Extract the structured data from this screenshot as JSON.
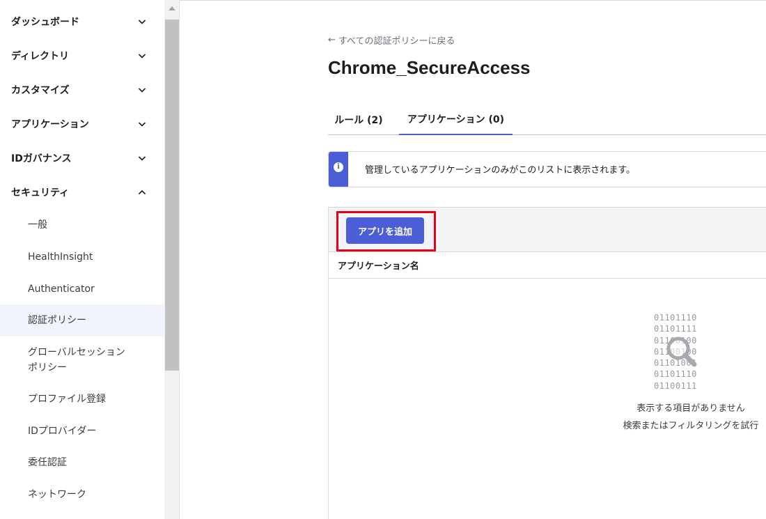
{
  "sidebar": {
    "top_items": [
      {
        "label": "ダッシュボード",
        "expanded": false
      },
      {
        "label": "ディレクトリ",
        "expanded": false
      },
      {
        "label": "カスタマイズ",
        "expanded": false
      },
      {
        "label": "アプリケーション",
        "expanded": false
      },
      {
        "label": "IDガバナンス",
        "expanded": false
      },
      {
        "label": "セキュリティ",
        "expanded": true
      }
    ],
    "security_items": [
      {
        "label": "一般"
      },
      {
        "label": "HealthInsight"
      },
      {
        "label": "Authenticator"
      },
      {
        "label": "認証ポリシー",
        "active": true
      },
      {
        "label": "グローバルセッション\nポリシー"
      },
      {
        "label": "プロファイル登録"
      },
      {
        "label": "IDプロバイダー"
      },
      {
        "label": "委任認証"
      },
      {
        "label": "ネットワーク"
      }
    ]
  },
  "main": {
    "back_link": "すべての認証ポリシーに戻る",
    "title": "Chrome_SecureAccess",
    "tabs": [
      {
        "label": "ルール (2)",
        "active": false
      },
      {
        "label": "アプリケーション (0)",
        "active": true
      }
    ],
    "callout": "管理しているアプリケーションのみがこのリストに表示されます。",
    "add_button": "アプリを追加",
    "column_header": "アプリケーション名",
    "empty_binary": [
      "01101110",
      "01101111",
      "01100100",
      "01100100",
      "01101001",
      "01101110",
      "01100111"
    ],
    "empty_title": "表示する項目がありません",
    "empty_subtitle": "検索またはフィルタリングを試行"
  },
  "colors": {
    "accent": "#4b5ed6",
    "highlight_box": "#e60012",
    "active_nav_bg": "#f1f3fd"
  }
}
